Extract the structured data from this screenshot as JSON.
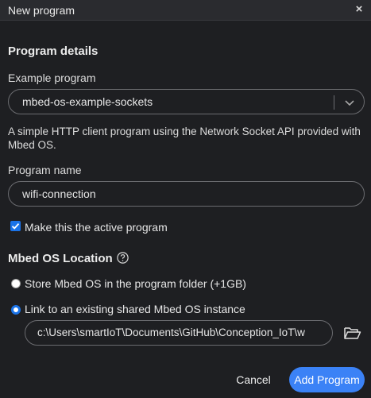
{
  "window": {
    "title": "New program",
    "close_glyph": "×"
  },
  "program_details": {
    "heading": "Program details",
    "example_label": "Example program",
    "example_value": "mbed-os-example-sockets",
    "description": "A simple HTTP client program using the Network Socket API provided with Mbed OS.",
    "name_label": "Program name",
    "name_value": "wifi-connection",
    "active_checkbox_label": "Make this the active program",
    "active_checked": true
  },
  "mbed_os_location": {
    "heading": "Mbed OS Location",
    "option_store_label": "Store Mbed OS in the program folder (+1GB)",
    "option_link_label": "Link to an existing shared Mbed OS instance",
    "selected_option": "link",
    "path_value": "c:\\Users\\smartIoT\\Documents\\GitHub\\Conception_IoT\\w"
  },
  "actions": {
    "cancel_label": "Cancel",
    "add_label": "Add Program"
  },
  "icons": {
    "close": "close-icon",
    "dropdown": "chevron-down-icon",
    "help": "help-circle-icon",
    "folder": "folder-open-icon",
    "checkbox": "check-icon"
  },
  "colors": {
    "background": "#1e1f22",
    "titlebar": "#2a2b2f",
    "accent": "#3b82f6",
    "checkbox": "#1a73e8",
    "border": "#6b6c70"
  }
}
